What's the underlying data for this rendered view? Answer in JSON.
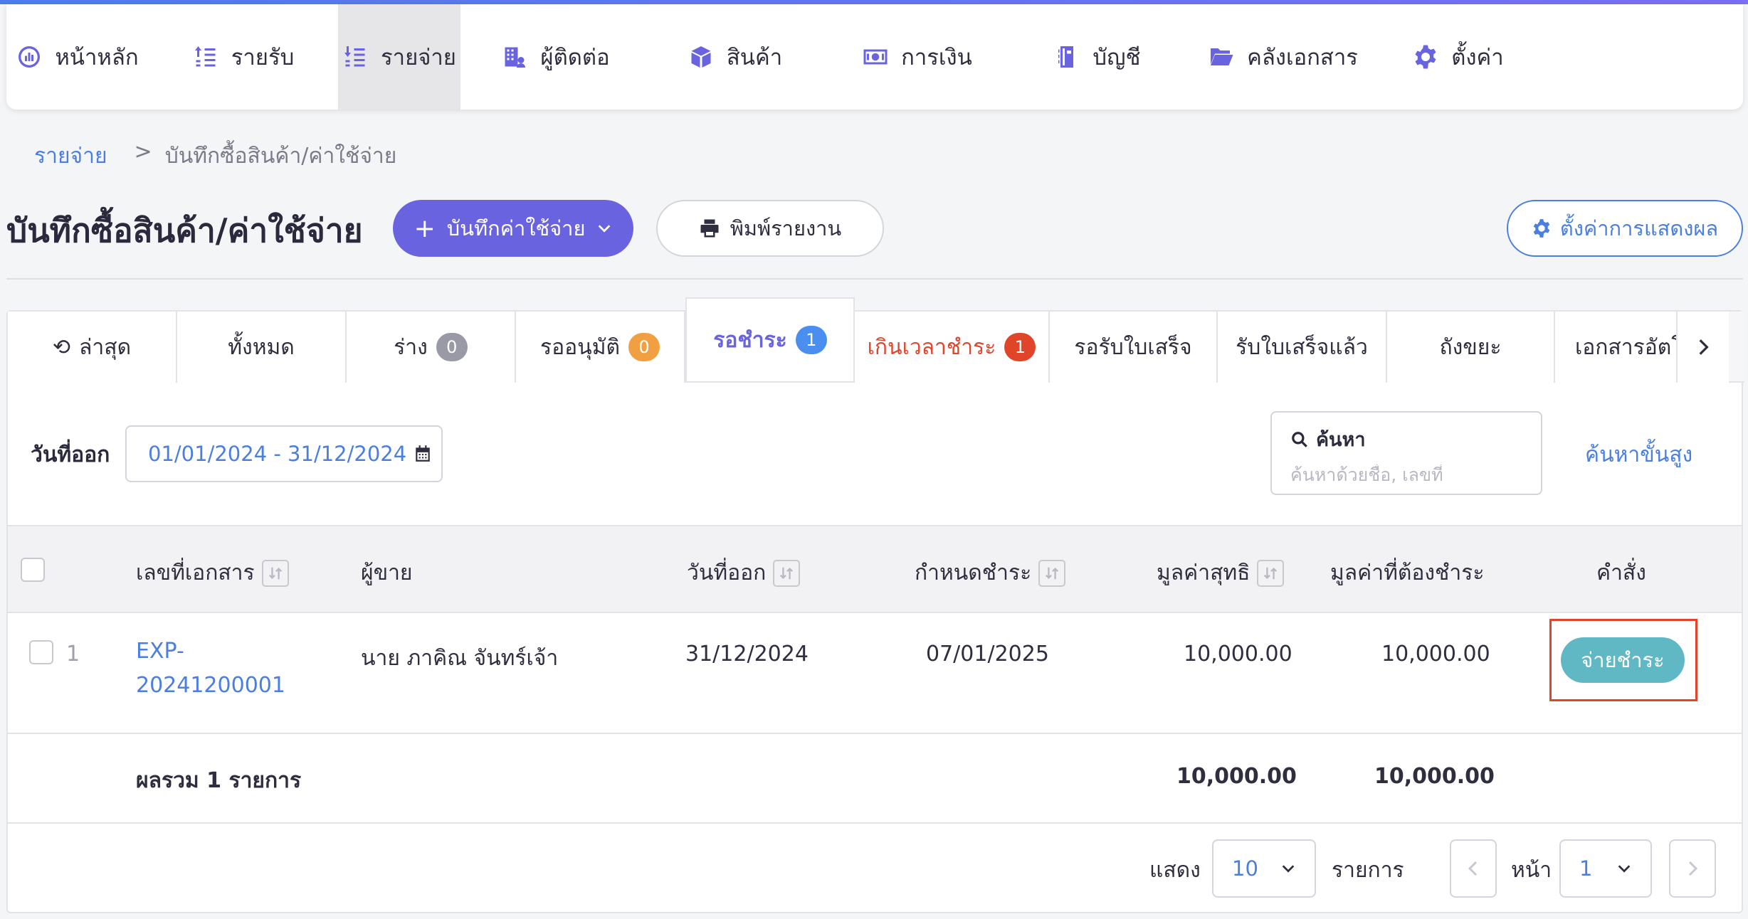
{
  "nav": {
    "items": [
      {
        "label": "หน้าหลัก",
        "icon": "dashboard-icon"
      },
      {
        "label": "รายรับ",
        "icon": "income-icon"
      },
      {
        "label": "รายจ่าย",
        "icon": "expense-icon"
      },
      {
        "label": "ผู้ติดต่อ",
        "icon": "contacts-icon"
      },
      {
        "label": "สินค้า",
        "icon": "product-box-icon"
      },
      {
        "label": "การเงิน",
        "icon": "money-icon"
      },
      {
        "label": "บัญชี",
        "icon": "ledger-icon"
      },
      {
        "label": "คลังเอกสาร",
        "icon": "folder-icon"
      },
      {
        "label": "ตั้งค่า",
        "icon": "gear-icon"
      }
    ]
  },
  "breadcrumb": {
    "parent": "รายจ่าย",
    "separator": ">",
    "current": "บันทึกซื้อสินค้า/ค่าใช้จ่าย"
  },
  "header": {
    "title": "บันทึกซื้อสินค้า/ค่าใช้จ่าย",
    "primary_button": "บันทึกค่าใช้จ่าย",
    "print_button": "พิมพ์รายงาน",
    "settings_button": "ตั้งค่าการแสดงผล"
  },
  "tabs": [
    {
      "label": "ล่าสุด"
    },
    {
      "label": "ทั้งหมด"
    },
    {
      "label": "ร่าง",
      "count": "0"
    },
    {
      "label": "รออนุมัติ",
      "count": "0"
    },
    {
      "label": "รอชำระ",
      "count": "1"
    },
    {
      "label": "เกินเวลาชำระ",
      "count": "1"
    },
    {
      "label": "รอรับใบเสร็จ"
    },
    {
      "label": "รับใบเสร็จแล้ว"
    },
    {
      "label": "ถังขยะ"
    },
    {
      "label": "เอกสารอัตโน"
    }
  ],
  "filter": {
    "date_label": "วันที่ออก",
    "date_range": "01/01/2024 - 31/12/2024",
    "search_label": "ค้นหา",
    "search_placeholder": "ค้นหาด้วยชื่อ, เลขที่",
    "advanced_search": "ค้นหาขั้นสูง"
  },
  "table": {
    "headers": {
      "doc_no": "เลขที่เอกสาร",
      "vendor": "ผู้ขาย",
      "issue_date": "วันที่ออก",
      "due_date": "กำหนดชำระ",
      "net_value": "มูลค่าสุทธิ",
      "amount_due": "มูลค่าที่ต้องชำระ",
      "action": "คำสั่ง"
    },
    "rows": [
      {
        "index": "1",
        "doc_no_line1": "EXP-",
        "doc_no_line2": "20241200001",
        "vendor": "นาย ภาคิณ จันทร์เจ้า",
        "issue_date": "31/12/2024",
        "due_date": "07/01/2025",
        "net_value": "10,000.00",
        "amount_due": "10,000.00",
        "action": "จ่ายชำระ"
      }
    ],
    "total": {
      "label": "ผลรวม 1 รายการ",
      "net_value": "10,000.00",
      "amount_due": "10,000.00"
    }
  },
  "pager": {
    "show_label": "แสดง",
    "page_size": "10",
    "items_label": "รายการ",
    "page_label": "หน้า",
    "page": "1"
  },
  "colors": {
    "accent": "#6a63e0",
    "link": "#4a7fe0",
    "overdue": "#e0452a",
    "pay": "#5fb8c4"
  }
}
